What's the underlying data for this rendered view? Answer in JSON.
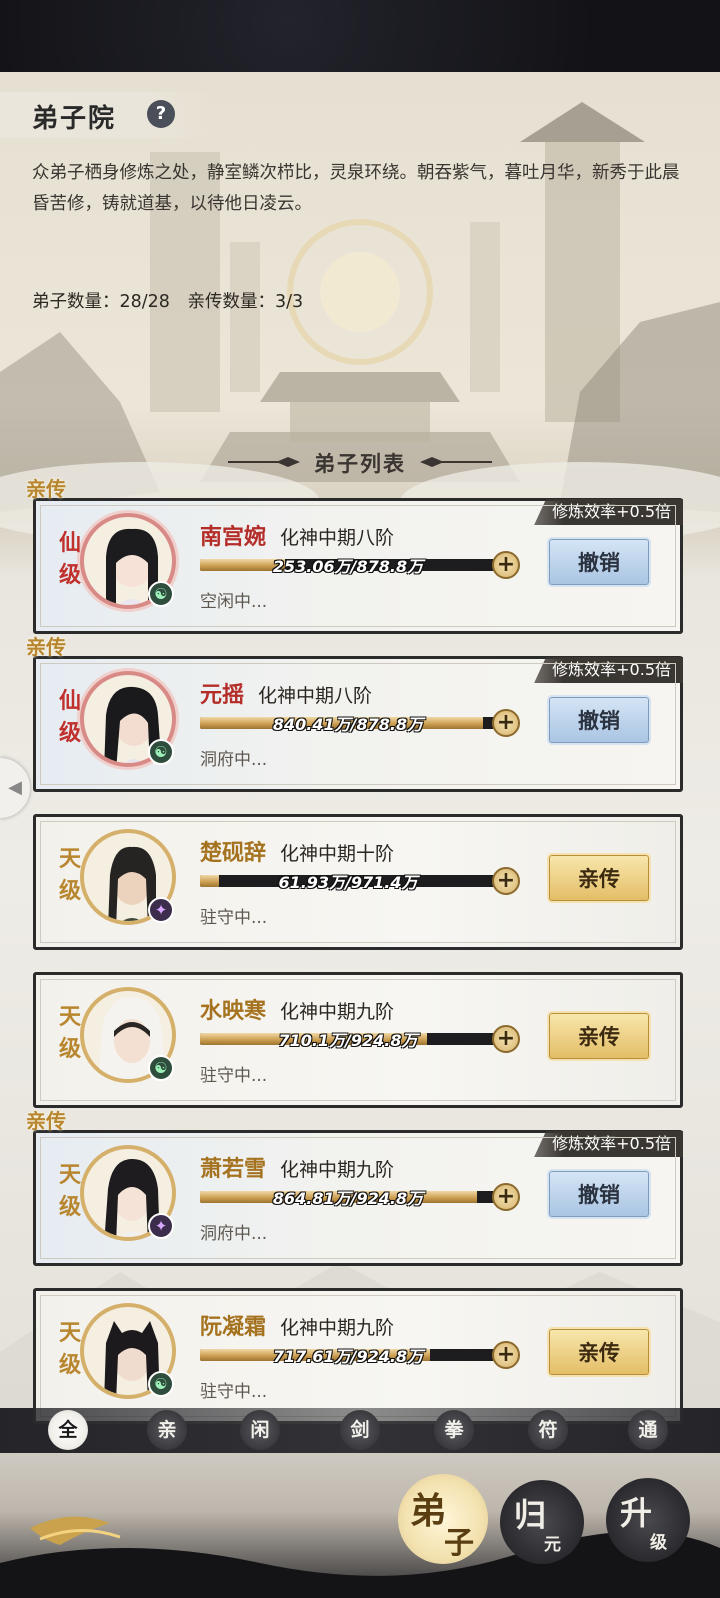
{
  "header": {
    "title": "弟子院",
    "help_icon": "?",
    "description": "众弟子栖身修炼之处，静室鳞次栉比，灵泉环绕。朝吞紫气，暮吐月华，新秀于此晨昏苦修，铸就道基，以待他日凌云。",
    "disciple_count": "弟子数量：28/28",
    "core_count": "亲传数量：3/3"
  },
  "list": {
    "title": "弟子列表",
    "core_tag": "亲传",
    "bonus": "修炼效率+0.5倍",
    "disciples": [
      {
        "rank": "仙级",
        "name": "南宫婉",
        "realm": "化神中期八阶",
        "exp": "253.06万/878.8万",
        "progress": 0.288,
        "status": "空闲中...",
        "action": "撤销",
        "core": true
      },
      {
        "rank": "仙级",
        "name": "元摇",
        "realm": "化神中期八阶",
        "exp": "840.41万/878.8万",
        "progress": 0.956,
        "status": "洞府中...",
        "action": "撤销",
        "core": true
      },
      {
        "rank": "天级",
        "name": "楚砚辞",
        "realm": "化神中期十阶",
        "exp": "61.93万/971.4万",
        "progress": 0.064,
        "status": "驻守中...",
        "action": "亲传",
        "core": false
      },
      {
        "rank": "天级",
        "name": "水映寒",
        "realm": "化神中期九阶",
        "exp": "710.1万/924.8万",
        "progress": 0.768,
        "status": "驻守中...",
        "action": "亲传",
        "core": false
      },
      {
        "rank": "天级",
        "name": "萧若雪",
        "realm": "化神中期九阶",
        "exp": "864.81万/924.8万",
        "progress": 0.935,
        "status": "洞府中...",
        "action": "撤销",
        "core": true
      },
      {
        "rank": "天级",
        "name": "阮凝霜",
        "realm": "化神中期九阶",
        "exp": "717.61万/924.8万",
        "progress": 0.776,
        "status": "驻守中...",
        "action": "亲传",
        "core": false
      }
    ]
  },
  "filters": [
    "全",
    "亲",
    "闲",
    "剑",
    "拳",
    "符",
    "通"
  ],
  "active_filter": "全",
  "nav": {
    "disciple": {
      "a": "弟",
      "b": "子"
    },
    "guiyuan": {
      "a": "归",
      "b": "元"
    },
    "upgrade": {
      "a": "升",
      "b": "级"
    }
  },
  "icons": [
    "help-icon",
    "element-icon",
    "plus-icon",
    "side-tab-icon"
  ]
}
